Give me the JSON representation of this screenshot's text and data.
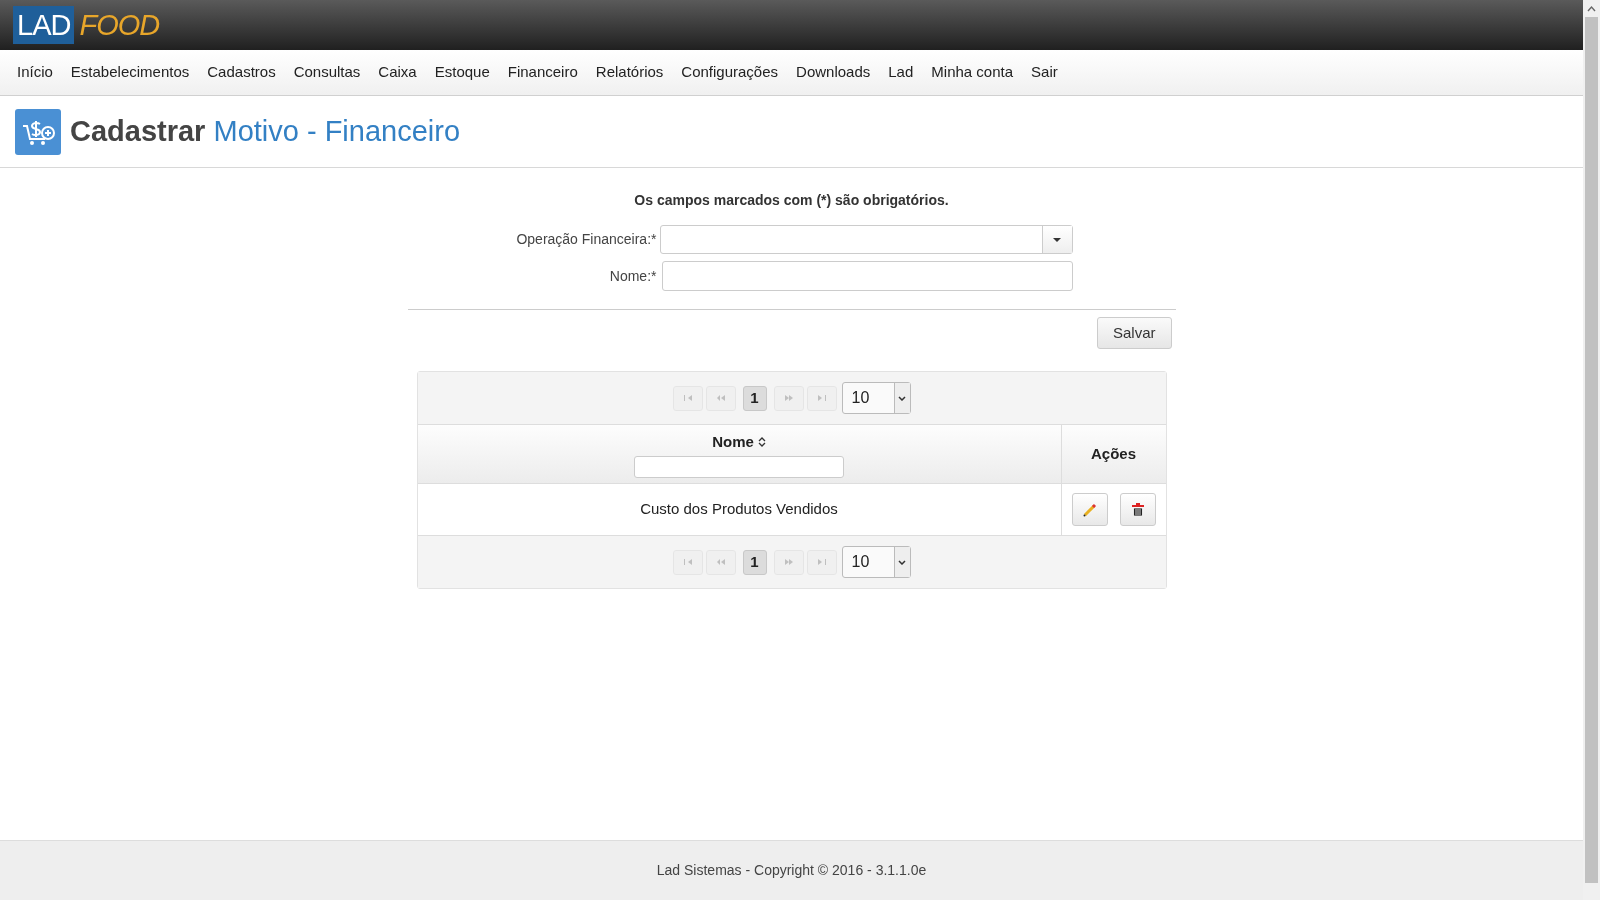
{
  "header": {
    "logo": {
      "part_1": "LAD",
      "part_2": "FOOD"
    }
  },
  "nav": [
    "Início",
    "Estabelecimentos",
    "Cadastros",
    "Consultas",
    "Caixa",
    "Estoque",
    "Financeiro",
    "Relatórios",
    "Configurações",
    "Downloads",
    "Lad",
    "Minha conta",
    "Sair"
  ],
  "page_title": {
    "prefix": "Cadastrar",
    "subject": "Motivo - Financeiro"
  },
  "form": {
    "notice": "Os campos marcados com (*) são obrigatórios.",
    "fields": [
      {
        "kind": "select",
        "label": "Operação Financeira:*"
      },
      {
        "kind": "text",
        "label": "Nome:*"
      }
    ],
    "save_button": "Salvar"
  },
  "table": {
    "top_pager": {
      "pages": [
        {
          "label": "1",
          "selected": true
        }
      ],
      "rows_per_page": "10"
    },
    "columns": [
      {
        "label": "Nome",
        "sortable": true,
        "filter": true
      },
      {
        "label": "Ações",
        "sortable": false,
        "filter": false
      }
    ],
    "rows": [
      {
        "nome": "Custo dos Produtos Vendidos"
      }
    ],
    "bottom_pager": {
      "pages": [
        {
          "label": "1",
          "selected": true
        }
      ],
      "rows_per_page": "10"
    }
  },
  "footer": "Lad Sistemas - Copyright © 2016 - 3.1.1.0e"
}
